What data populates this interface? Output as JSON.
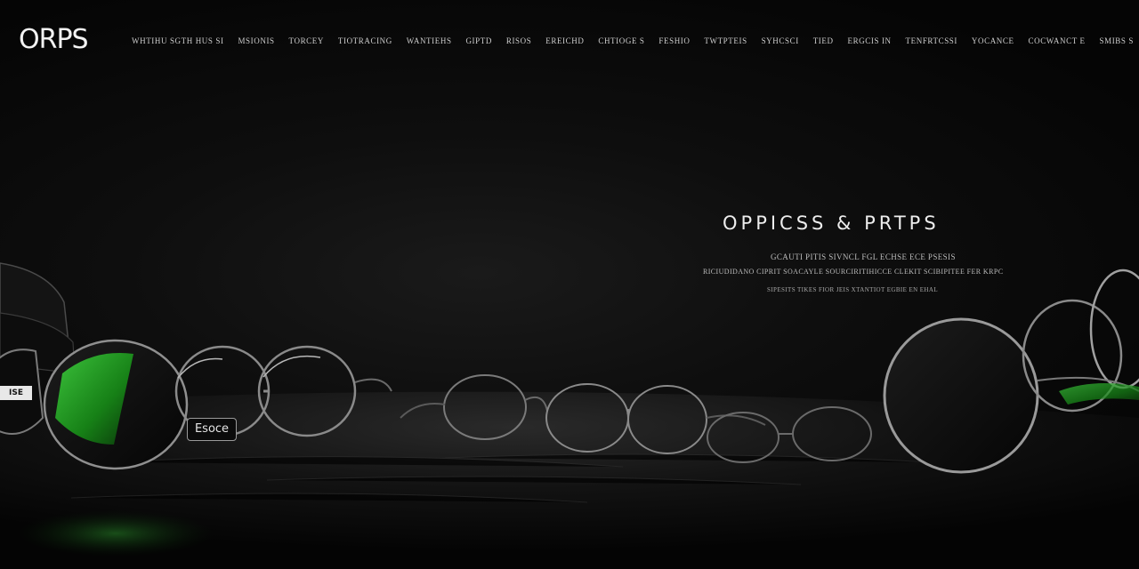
{
  "brand": {
    "logo_text": "ORPS",
    "accent_color": "#2fbf2f"
  },
  "nav": {
    "items": [
      {
        "label": "WHTIHU  SGTH  HUS  SI"
      },
      {
        "label": "MSIONIS"
      },
      {
        "label": "TORCEY"
      },
      {
        "label": "TIOTRACING"
      },
      {
        "label": "WANTIEHS"
      },
      {
        "label": "GIPTD"
      },
      {
        "label": "RISOS"
      },
      {
        "label": "EREICHD"
      },
      {
        "label": "CHTIOGE  S"
      },
      {
        "label": "FESHIO"
      },
      {
        "label": "TWTPTEIS"
      },
      {
        "label": "SYHCSCI"
      },
      {
        "label": "TIED"
      },
      {
        "label": "ERGCIS  IN"
      },
      {
        "label": "TENFRTCSSI"
      },
      {
        "label": "YOCANCE"
      },
      {
        "label": "COCWANCT  E"
      },
      {
        "label": "SMIBS  S"
      }
    ]
  },
  "hero": {
    "title": "OPPICSS & PRTPS",
    "line1": "GCAUTI  PITIS  SIVNCL  FGL  ECHSE  ECE  PSESIS",
    "line2": "RICIUDIDANO  CIPRIT  SOACAYLE  SOURCIRITIHICCE  CLEKIT  SCIBIPITEE  FER  KRPC",
    "line3": "SIPESITS  TIKES  FIOR  JEIS  XTANTIOT  EGBIE  EN  EHAL"
  },
  "scene": {
    "tag_label": "Esoce",
    "lens_badge": "ISE"
  }
}
